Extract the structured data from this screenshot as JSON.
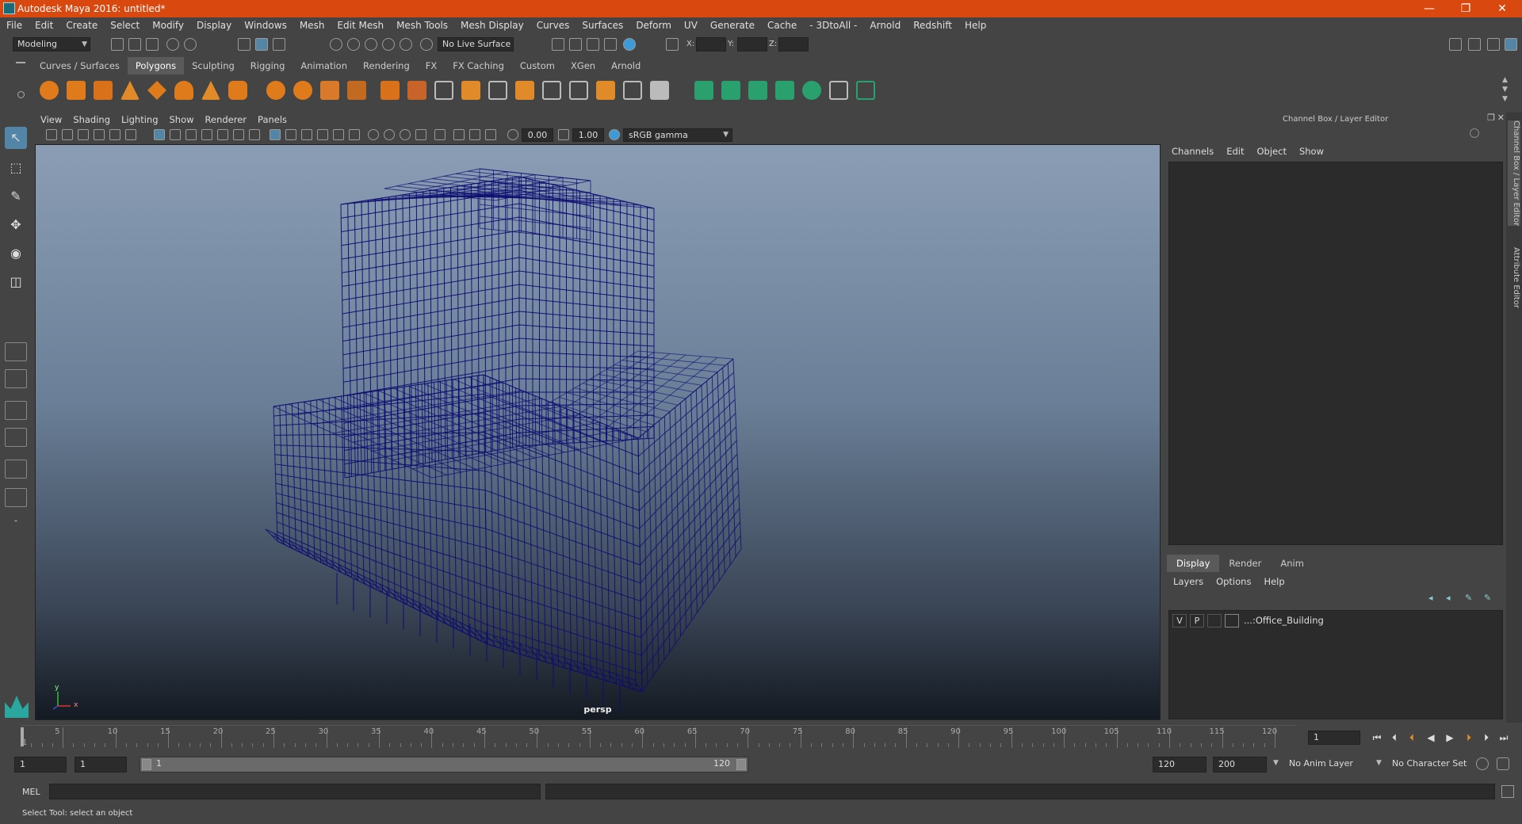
{
  "window": {
    "title": "Autodesk Maya 2016: untitled*",
    "minimize": "—",
    "maximize": "❐",
    "close": "✕"
  },
  "menubar": [
    "File",
    "Edit",
    "Create",
    "Select",
    "Modify",
    "Display",
    "Windows",
    "Mesh",
    "Edit Mesh",
    "Mesh Tools",
    "Mesh Display",
    "Curves",
    "Surfaces",
    "Deform",
    "UV",
    "Generate",
    "Cache",
    "- 3DtoAll -",
    "Arnold",
    "Redshift",
    "Help"
  ],
  "statusline": {
    "menuset": "Modeling",
    "live_surface": "No Live Surface",
    "x_label": "X:",
    "y_label": "Y:",
    "z_label": "Z:"
  },
  "shelf_tabs": [
    "Curves / Surfaces",
    "Polygons",
    "Sculpting",
    "Rigging",
    "Animation",
    "Rendering",
    "FX",
    "FX Caching",
    "Custom",
    "XGen",
    "Arnold"
  ],
  "shelf_active": "Polygons",
  "viewport": {
    "menus": [
      "View",
      "Shading",
      "Lighting",
      "Show",
      "Renderer",
      "Panels"
    ],
    "exposure": "0.00",
    "gamma": "1.00",
    "color_space": "sRGB gamma",
    "camera": "persp",
    "axis_y": "y",
    "axis_x": "x"
  },
  "channel_box": {
    "title": "Channel Box / Layer Editor",
    "menus": [
      "Channels",
      "Edit",
      "Object",
      "Show"
    ]
  },
  "layer_editor": {
    "tabs": [
      "Display",
      "Render",
      "Anim"
    ],
    "active_tab": "Display",
    "menus": [
      "Layers",
      "Options",
      "Help"
    ],
    "layer": {
      "v": "V",
      "p": "P",
      "name": "...:Office_Building"
    }
  },
  "side_tabs": [
    "Channel Box / Layer Editor",
    "Attribute Editor"
  ],
  "timeslider": {
    "ticks": [
      1,
      5,
      10,
      15,
      20,
      25,
      30,
      35,
      40,
      45,
      50,
      55,
      60,
      65,
      70,
      75,
      80,
      85,
      90,
      95,
      100,
      105,
      110,
      115,
      120
    ],
    "current_frame": "1"
  },
  "range": {
    "start": "1",
    "playback_start": "1",
    "range_start_label": "1",
    "range_end_label": "120",
    "playback_end": "120",
    "end": "200",
    "anim_layer": "No Anim Layer",
    "character_set": "No Character Set"
  },
  "command": {
    "label": "MEL"
  },
  "help_line": "Select Tool: select an object",
  "colors": {
    "title_bar": "#d9480f",
    "wireframe": "#0d0d70",
    "active_tool": "#5285a6"
  }
}
